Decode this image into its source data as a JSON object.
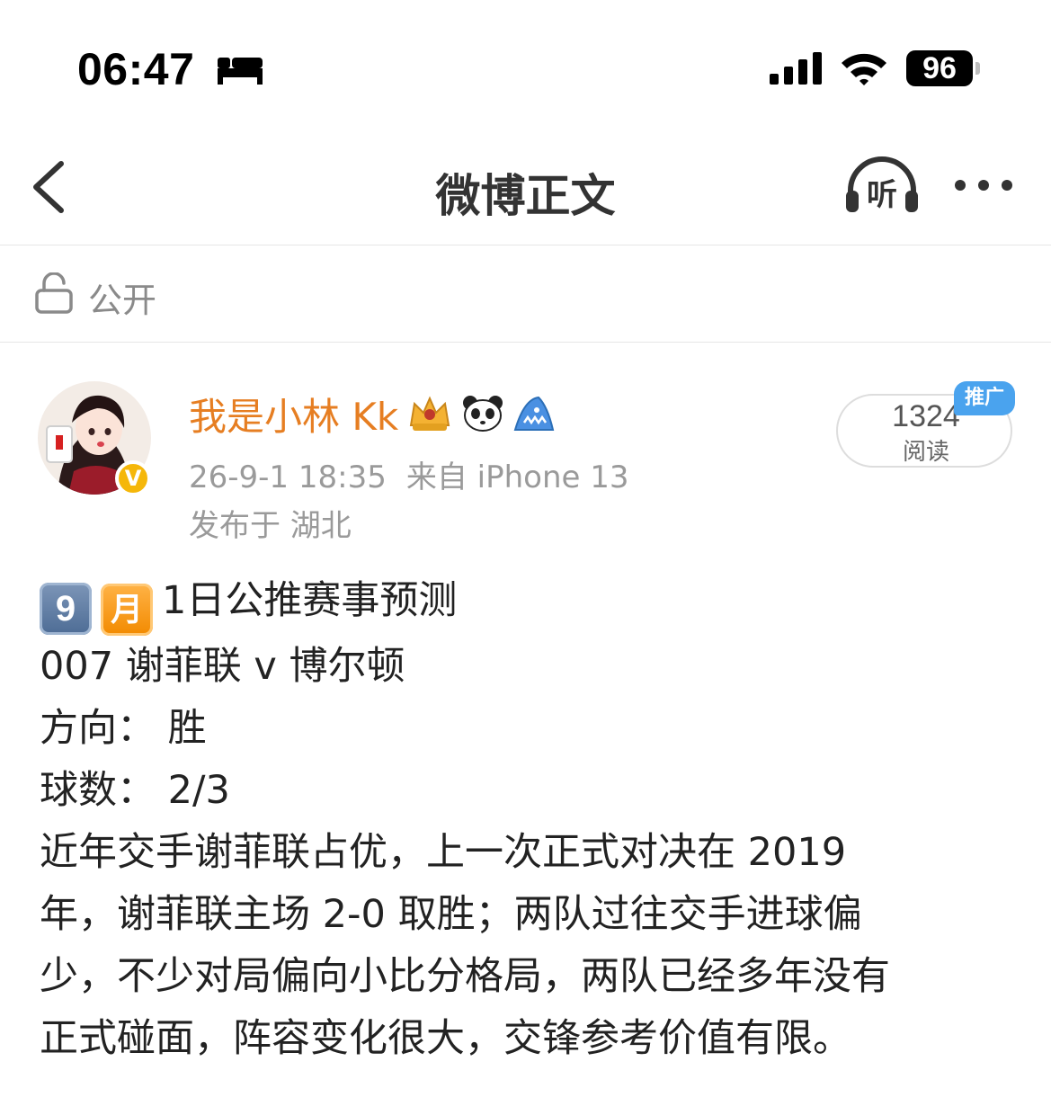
{
  "status_bar": {
    "time": "06:47",
    "battery": "96",
    "icons": [
      "sleep-focus-icon",
      "cellular-signal-icon",
      "wifi-icon",
      "battery-icon"
    ]
  },
  "nav": {
    "title": "微博正文",
    "listen_label": "听",
    "icons": [
      "back-chevron-icon",
      "listen-headphones-icon",
      "more-dots-icon"
    ]
  },
  "visibility": {
    "label": "公开",
    "icon": "unlock-icon"
  },
  "post": {
    "username": "我是小林 Kk",
    "username_color": "#e67e22",
    "badges": [
      "crown-badge-icon",
      "panda-badge-icon",
      "shark-badge-icon"
    ],
    "verified": "V",
    "date": "26-9-1 18:35",
    "source": "来自 iPhone 13",
    "location": "发布于 湖北",
    "read_count": "1324",
    "read_label": "阅读",
    "promo_tag": "推广",
    "title_month_key": "9",
    "title_month_char": "月",
    "title_rest": "1日公推赛事预测",
    "lines": [
      "007 谢菲联 v 博尔顿",
      "方向：  胜",
      "球数：  2/3",
      "近年交手谢菲联占优，上一次正式对决在 2019",
      "年，谢菲联主场 2-0 取胜；两队过往交手进球偏",
      "少，不少对局偏向小比分格局，两队已经多年没有",
      "正式碰面，阵容变化很大，交锋参考价值有限。"
    ]
  }
}
